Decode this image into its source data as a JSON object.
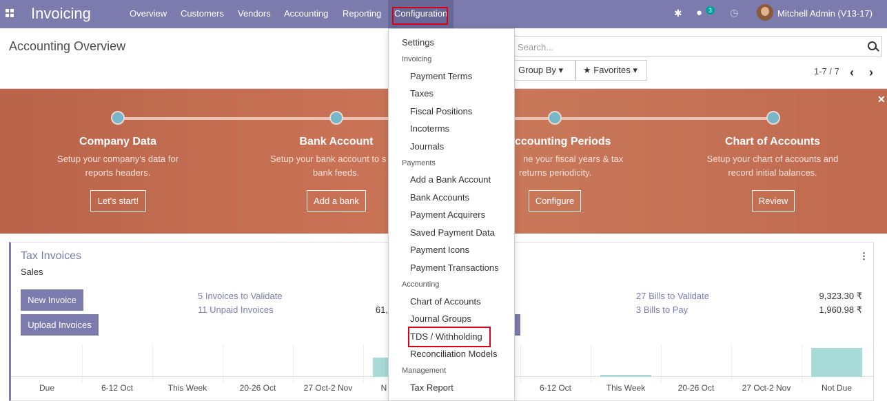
{
  "topbar": {
    "brand": "Invoicing",
    "menu": [
      "Overview",
      "Customers",
      "Vendors",
      "Accounting",
      "Reporting"
    ],
    "active_menu": "Configuration",
    "messages_count": "3",
    "user": "Mitchell Admin (V13-17)"
  },
  "control_panel": {
    "title": "Accounting Overview",
    "search_placeholder": "Search...",
    "group_by": "Group By",
    "favorites": "Favorites",
    "pager": "1-7 / 7"
  },
  "onboarding": {
    "steps": [
      {
        "title": "Company Data",
        "desc1": "Setup your company's data for",
        "desc2": "reports headers.",
        "button": "Let's start!"
      },
      {
        "title": "Bank Account",
        "desc1": "Setup your bank account to s",
        "desc2": "bank feeds.",
        "button": "Add a bank"
      },
      {
        "title": "ccounting Periods",
        "desc1": "ne your fiscal years & tax",
        "desc2": "returns periodicity.",
        "button": "Configure"
      },
      {
        "title": "Chart of Accounts",
        "desc1": "Setup your chart of accounts and",
        "desc2": "record initial balances.",
        "button": "Review"
      }
    ]
  },
  "sales_card": {
    "title": "Tax Invoices",
    "subtitle": "Sales",
    "new_invoice": "New Invoice",
    "upload_invoices": "Upload Invoices",
    "link1": "5 Invoices to Validate",
    "link2": "11 Unpaid Invoices",
    "amount1": "",
    "amount2": "61,"
  },
  "purchase_card": {
    "title": "s",
    "link1": "27 Bills to Validate",
    "link2": "3 Bills to Pay",
    "amount1": "9,323.30 ₹",
    "amount2": "1,960.98 ₹"
  },
  "graph_labels": {
    "left": [
      "Due",
      "6-12 Oct",
      "This Week",
      "20-26 Oct",
      "27 Oct-2 Nov",
      "N"
    ],
    "right": [
      "6-12 Oct",
      "This Week",
      "20-26 Oct",
      "27 Oct-2 Nov",
      "Not Due"
    ]
  },
  "dropdown": {
    "settings": "Settings",
    "invoicing_header": "Invoicing",
    "invoicing": [
      "Payment Terms",
      "Taxes",
      "Fiscal Positions",
      "Incoterms",
      "Journals"
    ],
    "payments_header": "Payments",
    "payments": [
      "Add a Bank Account",
      "Bank Accounts",
      "Payment Acquirers",
      "Saved Payment Data",
      "Payment Icons",
      "Payment Transactions"
    ],
    "accounting_header": "Accounting",
    "accounting": [
      "Chart of Accounts",
      "Journal Groups",
      "TDS / Withholding",
      "Reconciliation Models"
    ],
    "management_header": "Management",
    "management": [
      "Tax Report"
    ]
  }
}
